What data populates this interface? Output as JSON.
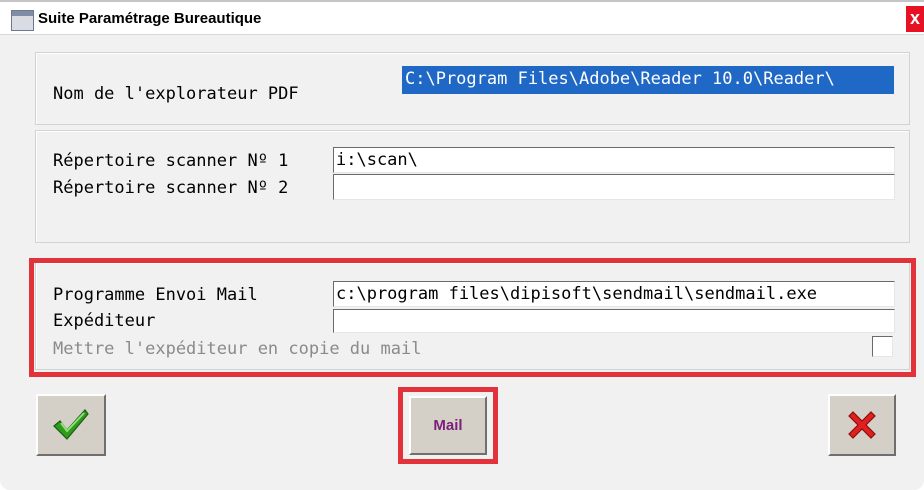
{
  "window": {
    "title": "Suite Paramétrage Bureautique",
    "close_label": "x"
  },
  "pdf": {
    "label": "Nom de l'explorateur PDF",
    "value": "C:\\Program Files\\Adobe\\Reader 10.0\\Reader\\"
  },
  "scanner": {
    "dir1_label": "Répertoire scanner Nº 1",
    "dir1_value": "i:\\scan\\",
    "dir2_label": "Répertoire scanner Nº 2",
    "dir2_value": ""
  },
  "mail": {
    "program_label": "Programme Envoi Mail",
    "program_value": "c:\\program files\\dipisoft\\sendmail\\sendmail.exe",
    "sender_label": "Expéditeur",
    "sender_value": "",
    "cc_label": "Mettre l'expéditeur en copie du mail",
    "cc_checked": false
  },
  "buttons": {
    "mail_label": "Mail"
  },
  "colors": {
    "highlight": "#e2333a",
    "selection": "#1f68c6",
    "ok_icon": "#2f9a1c",
    "cancel_icon": "#e02020"
  },
  "icons": {
    "ok": "checkmark-icon",
    "cancel": "red-x-icon",
    "app": "window-app-icon"
  }
}
